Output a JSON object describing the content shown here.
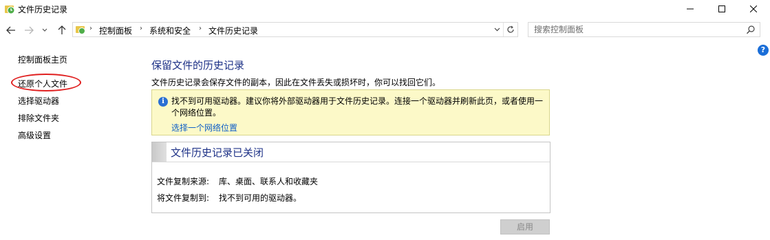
{
  "window": {
    "title": "文件历史记录",
    "controls": [
      "minimize",
      "maximize",
      "close"
    ]
  },
  "nav": {
    "breadcrumbs": [
      "控制面板",
      "系统和安全",
      "文件历史记录"
    ],
    "search_placeholder": "搜索控制面板"
  },
  "help_label": "?",
  "sidebar": {
    "items": [
      {
        "label": "控制面板主页"
      },
      {
        "label": "还原个人文件"
      },
      {
        "label": "选择驱动器"
      },
      {
        "label": "排除文件夹"
      },
      {
        "label": "高级设置"
      }
    ]
  },
  "main": {
    "title": "保留文件的历史记录",
    "description": "文件历史记录会保存文件的副本，因此在文件丢失或损坏时，你可以找回它们。",
    "warning": {
      "icon_label": "i",
      "text": "找不到可用驱动器。建议你将外部驱动器用于文件历史记录。连接一个驱动器并刷新此页，或者使用一个网络位置。",
      "link": "选择一个网络位置"
    },
    "status": {
      "title": "文件历史记录已关闭",
      "rows": [
        {
          "label": "文件复制来源:",
          "value": "库、桌面、联系人和收藏夹"
        },
        {
          "label": "将文件复制到:",
          "value": "找不到可用的驱动器。"
        }
      ]
    },
    "enable_button": "启用"
  },
  "colors": {
    "heading": "#1e3287",
    "link": "#0f5fc7",
    "warning_bg": "#fcf9c8",
    "annotation": "#e02020"
  }
}
